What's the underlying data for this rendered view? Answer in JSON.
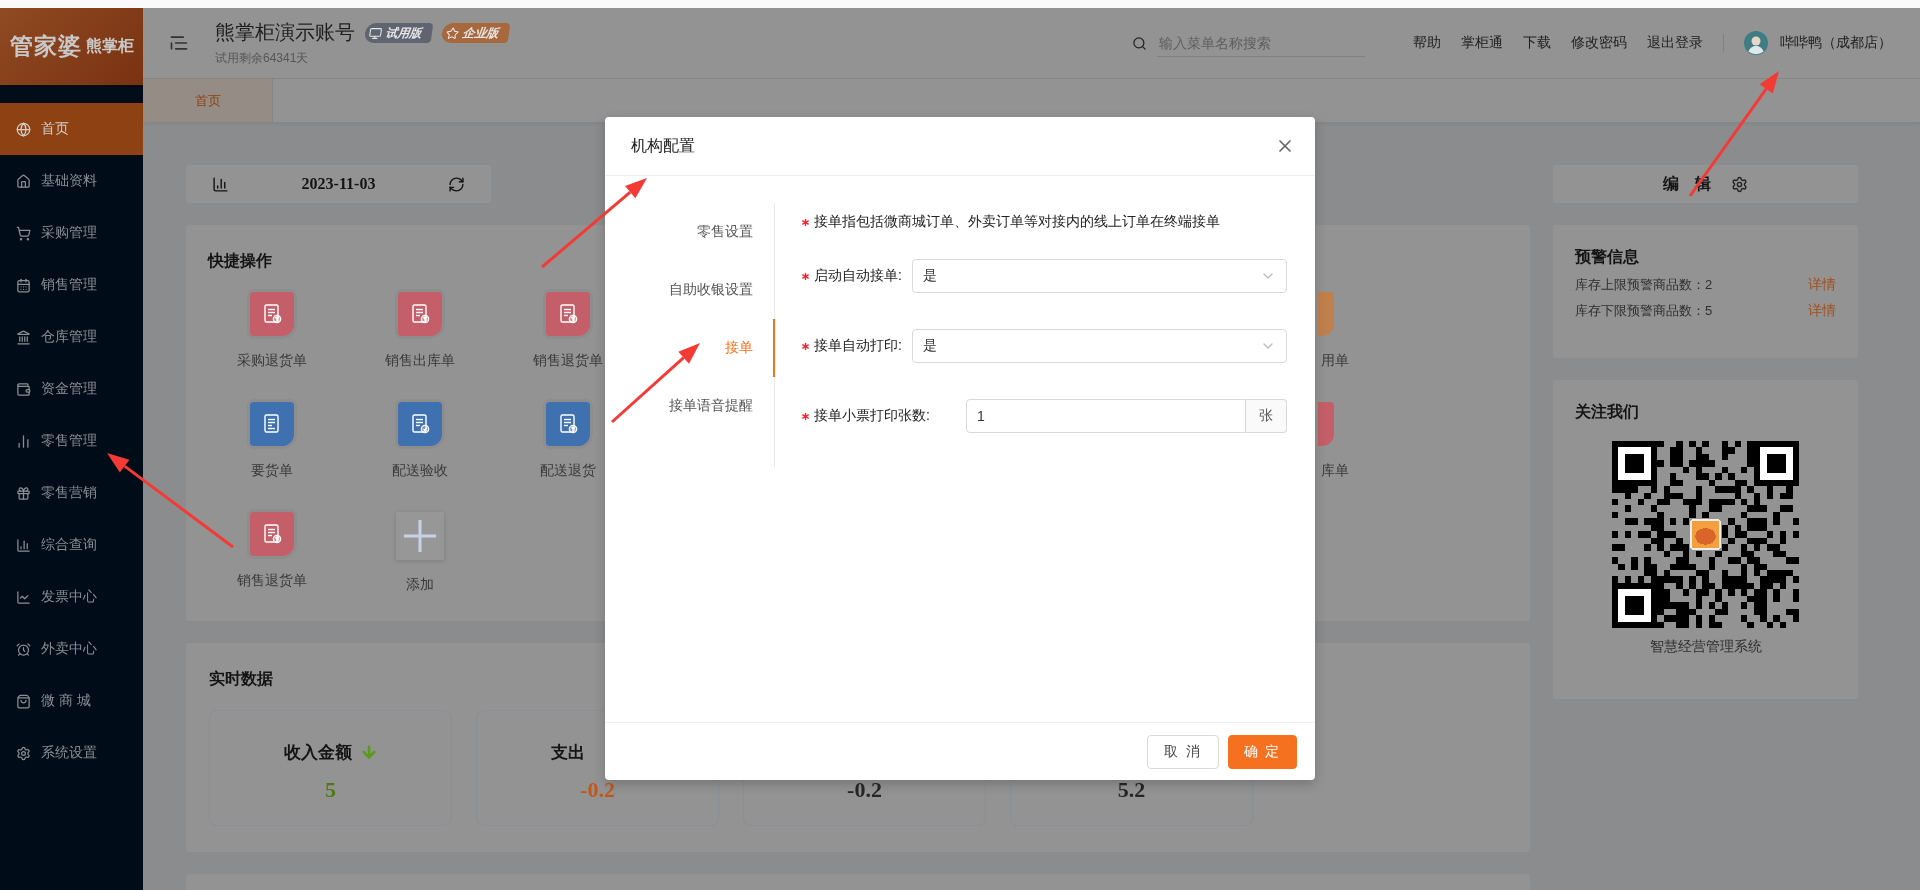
{
  "sidebar": {
    "logo": {
      "brand": "管家婆",
      "product": "熊掌柜"
    },
    "items": [
      {
        "label": "首页",
        "selected": true
      },
      {
        "label": "基础资料",
        "selected": false
      },
      {
        "label": "采购管理",
        "selected": false
      },
      {
        "label": "销售管理",
        "selected": false
      },
      {
        "label": "仓库管理",
        "selected": false
      },
      {
        "label": "资金管理",
        "selected": false
      },
      {
        "label": "零售管理",
        "selected": false
      },
      {
        "label": "零售营销",
        "selected": false
      },
      {
        "label": "综合查询",
        "selected": false
      },
      {
        "label": "发票中心",
        "selected": false
      },
      {
        "label": "外卖中心",
        "selected": false
      },
      {
        "label": "微 商 城",
        "selected": false
      },
      {
        "label": "系统设置",
        "selected": false
      }
    ]
  },
  "header": {
    "account": "熊掌柜演示账号",
    "badges": [
      {
        "label": "试用版",
        "kind": "trial"
      },
      {
        "label": "企业版",
        "kind": "enterprise"
      }
    ],
    "subtitle": "试用剩余64341天",
    "search": {
      "placeholder": "输入菜单名称搜索"
    },
    "links": [
      "帮助",
      "掌柜通",
      "下载",
      "修改密码",
      "退出登录"
    ],
    "user": "哔哔鸭（成都店）"
  },
  "tabs": [
    {
      "label": "首页",
      "selected": true
    }
  ],
  "date_bar": {
    "date": "2023-11-03"
  },
  "quick_actions": {
    "title": "快捷操作",
    "rows": [
      {
        "items": [
          {
            "label": "采购退货单",
            "color": "#c45f69",
            "kind": "upload"
          },
          {
            "label": "销售出库单",
            "color": "#c45f69",
            "kind": "upload"
          },
          {
            "label": "销售退货单",
            "color": "#c45f69",
            "kind": "upload"
          }
        ],
        "edge": {
          "label": "用单",
          "color": "#c0804e"
        }
      },
      {
        "items": [
          {
            "label": "要货单",
            "color": "#3f70b0",
            "kind": "list"
          },
          {
            "label": "配送验收",
            "color": "#3f70b0",
            "kind": "check"
          },
          {
            "label": "配送退货",
            "color": "#3f70b0",
            "kind": "upload"
          }
        ],
        "edge": {
          "label": "库单",
          "color": "#c45f69"
        }
      },
      {
        "items": [
          {
            "label": "销售退货单",
            "color": "#c45f69",
            "kind": "upload"
          },
          {
            "label": "添加",
            "kind": "add"
          }
        ]
      }
    ]
  },
  "realtime": {
    "title": "实时数据",
    "stats": [
      {
        "label": "收入金额",
        "trend_down": true,
        "value": "5",
        "color": "#4a7a10"
      },
      {
        "label": "支出",
        "value": "-0.2",
        "color": "#c0581c"
      },
      {
        "value": "-0.2",
        "color": "#262626"
      },
      {
        "value": "5.2",
        "color": "#262626"
      }
    ]
  },
  "edit_bar": {
    "label": "编 辑"
  },
  "alerts": {
    "title": "预警信息",
    "rows": [
      {
        "label": "库存上限预警商品数：2",
        "link": "详情"
      },
      {
        "label": "库存下限预警商品数：5",
        "link": "详情"
      }
    ]
  },
  "follow": {
    "title": "关注我们",
    "caption": "智慧经营管理系统"
  },
  "dialog": {
    "title": "机构配置",
    "nav": [
      {
        "label": "零售设置",
        "selected": false
      },
      {
        "label": "自助收银设置",
        "selected": false
      },
      {
        "label": "接单",
        "selected": true
      },
      {
        "label": "接单语音提醒",
        "selected": false
      }
    ],
    "note": {
      "text": "接单指包括微商城订单、外卖订单等对接内的线上订单在终端接单",
      "required": true
    },
    "fields": [
      {
        "kind": "select",
        "label": "启动自动接单:",
        "value": "是",
        "required": true
      },
      {
        "kind": "select",
        "label": "接单自动打印:",
        "value": "是",
        "required": true
      },
      {
        "kind": "number",
        "label": "接单小票打印张数:",
        "value": "1",
        "unit": "张",
        "required": true
      }
    ],
    "buttons": [
      {
        "label": "取 消",
        "kind": "default"
      },
      {
        "label": "确 定",
        "kind": "primary"
      }
    ]
  }
}
